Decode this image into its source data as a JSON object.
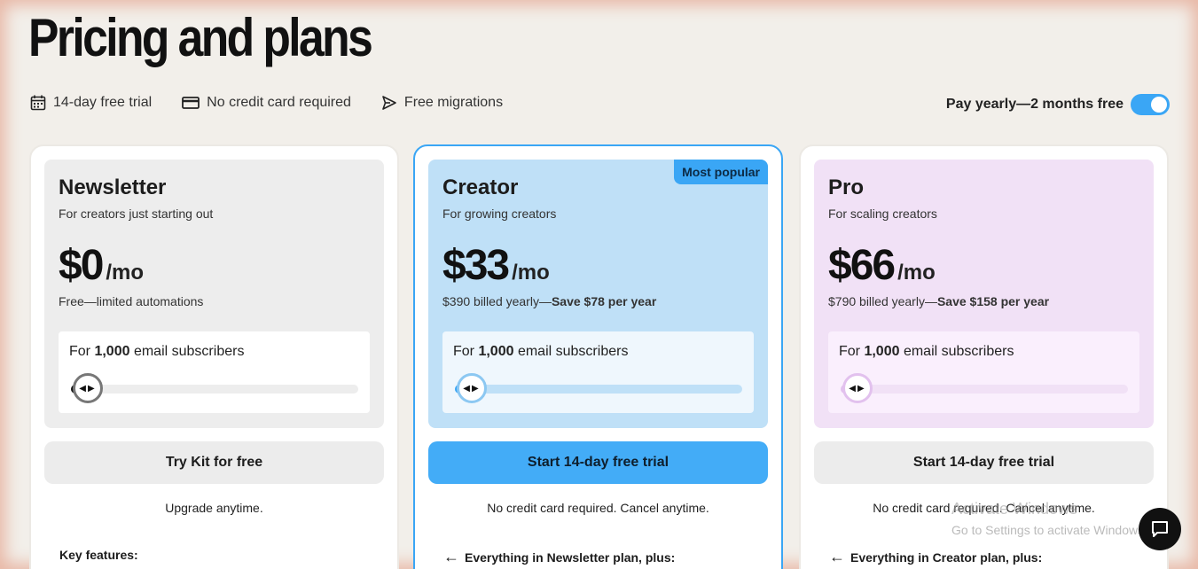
{
  "page": {
    "title": "Pricing and plans"
  },
  "perks": [
    {
      "icon": "calendar-icon",
      "label": "14-day free trial"
    },
    {
      "icon": "credit-card-icon",
      "label": "No credit card required"
    },
    {
      "icon": "send-icon",
      "label": "Free migrations"
    }
  ],
  "billing_toggle": {
    "label": "Pay yearly—2 months free",
    "enabled": true
  },
  "plans": [
    {
      "name": "Newsletter",
      "description": "For creators just starting out",
      "price": "$0",
      "period": "/mo",
      "note": "Free—limited automations",
      "note_bold": "",
      "subscribers_prefix": "For",
      "subscribers_count": "1,000",
      "subscribers_suffix": "email subscribers",
      "cta": "Try Kit for free",
      "cta_note": "Upgrade anytime.",
      "features_heading": "Key features:"
    },
    {
      "name": "Creator",
      "badge": "Most popular",
      "description": "For growing creators",
      "price": "$33",
      "period": "/mo",
      "note": "$390 billed yearly—",
      "note_bold": "Save $78 per year",
      "subscribers_prefix": "For",
      "subscribers_count": "1,000",
      "subscribers_suffix": "email subscribers",
      "cta": "Start 14-day free trial",
      "cta_note": "No credit card required. Cancel anytime.",
      "features_heading": "Everything in Newsletter plan, plus:"
    },
    {
      "name": "Pro",
      "description": "For scaling creators",
      "price": "$66",
      "period": "/mo",
      "note": "$790 billed yearly—",
      "note_bold": "Save $158 per year",
      "subscribers_prefix": "For",
      "subscribers_count": "1,000",
      "subscribers_suffix": "email subscribers",
      "cta": "Start 14-day free trial",
      "cta_note": "No credit card required. Cancel anytime.",
      "features_heading": "Everything in Creator plan, plus:"
    }
  ],
  "slider_thumb_glyph": "◀▶",
  "back_arrow_glyph": "←",
  "os_overlay": {
    "title": "Activate Windows",
    "subtitle": "Go to Settings to activate Windows."
  },
  "colors": {
    "accent": "#3aa6f5",
    "creator_panel": "#bfe0f7",
    "pro_panel": "#f1e1f6"
  }
}
